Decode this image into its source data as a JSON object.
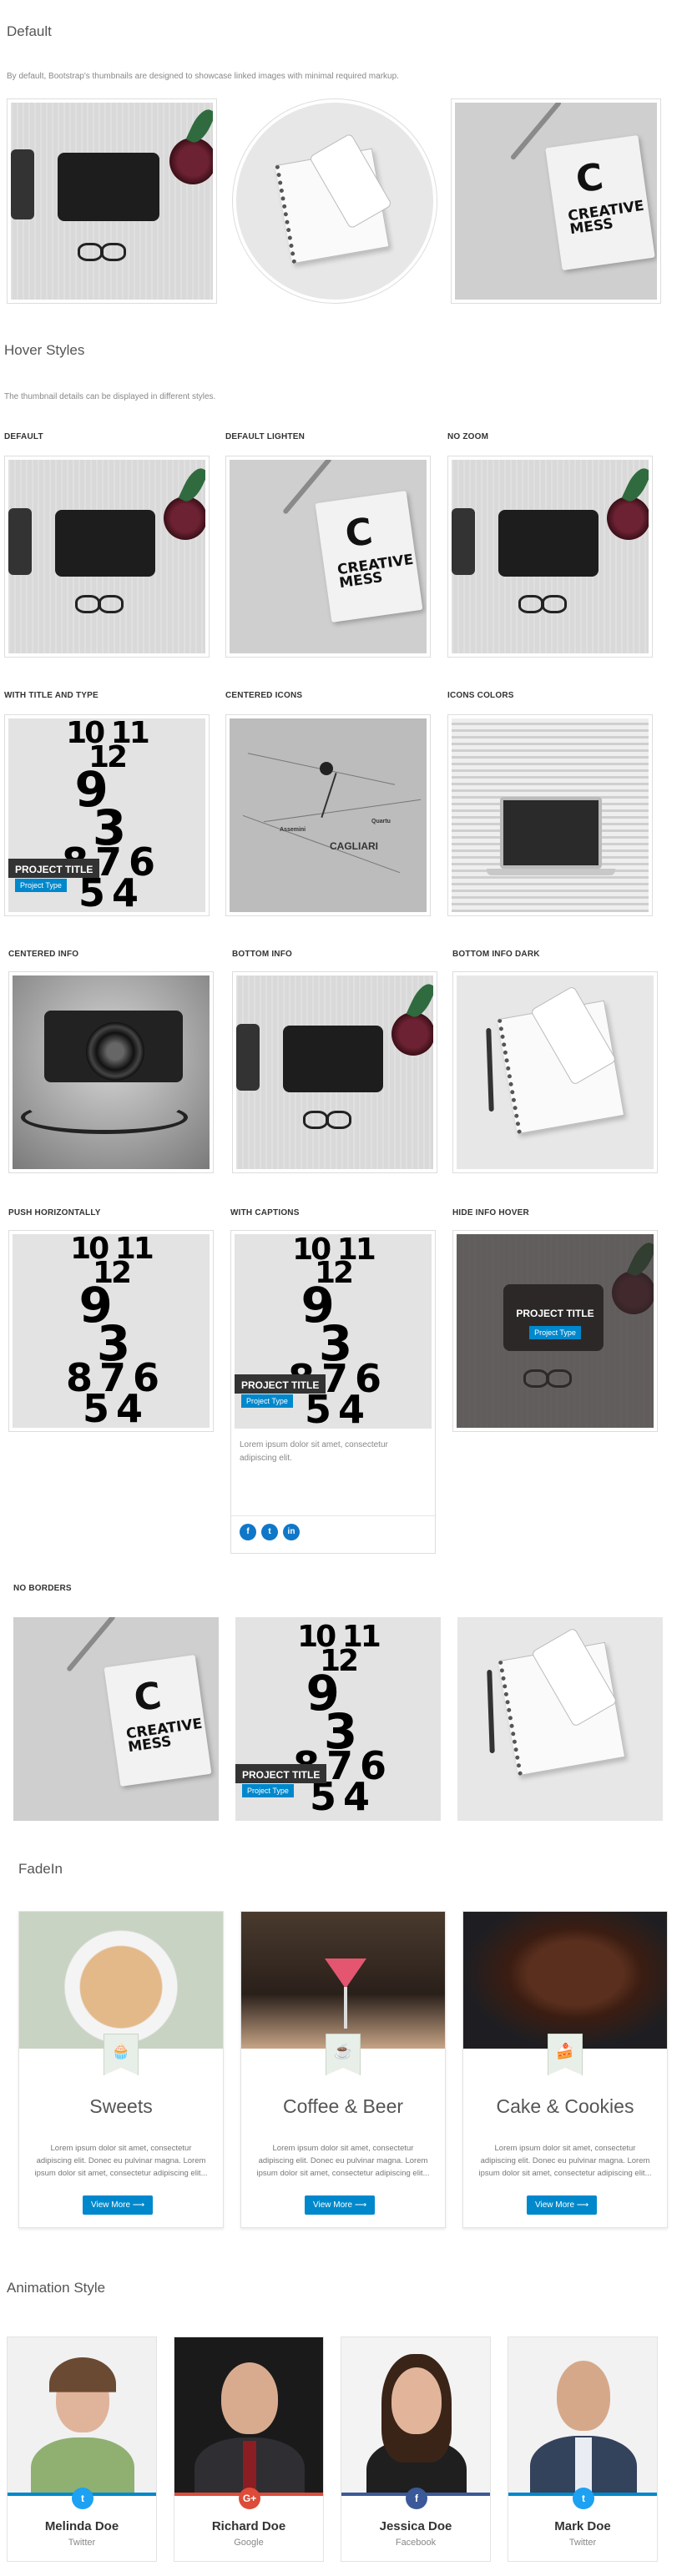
{
  "sections": {
    "default": {
      "title": "Default",
      "description": "By default, Bootstrap's thumbnails are designed to showcase linked images with minimal required markup."
    },
    "hover": {
      "title": "Hover Styles",
      "description": "The thumbnail details can be displayed in different styles.",
      "labels": {
        "default": "DEFAULT",
        "default_lighten": "DEFAULT LIGHTEN",
        "no_zoom": "NO ZOOM",
        "with_title_and_type": "WITH TITLE AND TYPE",
        "centered_icons": "CENTERED ICONS",
        "icons_colors": "ICONS COLORS",
        "centered_info": "CENTERED INFO",
        "bottom_info": "BOTTOM INFO",
        "bottom_info_dark": "BOTTOM INFO DARK",
        "push_horizontally": "PUSH HORIZONTALLY",
        "with_captions": "WITH CAPTIONS",
        "hide_info_hover": "HIDE INFO HOVER",
        "no_borders": "NO BORDERS"
      },
      "project_title": "PROJECT TITLE",
      "project_type": "Project Type",
      "caption_text": "Lorem ipsum dolor sit amet, consectetur adipiscing elit.",
      "socials": [
        "f",
        "t",
        "in"
      ]
    },
    "fadein": {
      "title": "FadeIn",
      "cards": [
        {
          "title": "Sweets",
          "icon": "🧁",
          "text": "Lorem ipsum dolor sit amet, consectetur adipiscing elit. Donec eu pulvinar magna. Lorem ipsum dolor sit amet, consectetur adipiscing elit...",
          "button": "View More ⟶"
        },
        {
          "title": "Coffee & Beer",
          "icon": "☕",
          "text": "Lorem ipsum dolor sit amet, consectetur adipiscing elit. Donec eu pulvinar magna. Lorem ipsum dolor sit amet, consectetur adipiscing elit...",
          "button": "View More ⟶"
        },
        {
          "title": "Cake & Cookies",
          "icon": "🍰",
          "text": "Lorem ipsum dolor sit amet, consectetur adipiscing elit. Donec eu pulvinar magna. Lorem ipsum dolor sit amet, consectetur adipiscing elit...",
          "button": "View More ⟶"
        }
      ]
    },
    "animation": {
      "title": "Animation Style",
      "team": [
        {
          "name": "Melinda Doe",
          "role": "Twitter",
          "icon": "t",
          "icon_color": "#1da1f2"
        },
        {
          "name": "Richard Doe",
          "role": "Google",
          "icon": "G+",
          "icon_color": "#dd4b39"
        },
        {
          "name": "Jessica Doe",
          "role": "Facebook",
          "icon": "f",
          "icon_color": "#3b5998"
        },
        {
          "name": "Mark Doe",
          "role": "Twitter",
          "icon": "t",
          "icon_color": "#1da1f2"
        }
      ]
    }
  },
  "colors": {
    "accent": "#0088cc",
    "title_bg": "#333333"
  }
}
